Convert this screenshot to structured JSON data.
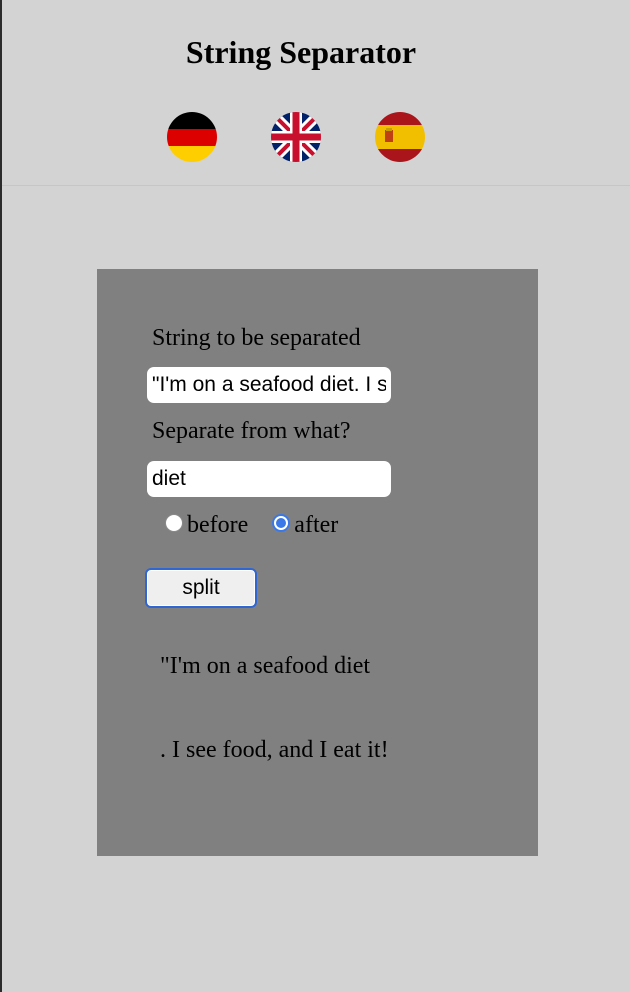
{
  "header": {
    "title": "String Separator",
    "languages": [
      {
        "code": "de",
        "icon": "germany-flag-icon"
      },
      {
        "code": "en",
        "icon": "uk-flag-icon"
      },
      {
        "code": "es",
        "icon": "spain-flag-icon"
      }
    ]
  },
  "form": {
    "string_label": "String to be separated",
    "string_value": "\"I'm on a seafood diet. I see food, and I eat it!",
    "separator_label": "Separate from what?",
    "separator_value": "diet",
    "options": [
      {
        "label": "before",
        "checked": false
      },
      {
        "label": "after",
        "checked": true
      }
    ],
    "split_label": "split"
  },
  "results": {
    "part1": "\"I'm on a seafood diet",
    "part2": ". I see food, and I eat it!"
  },
  "colors": {
    "background": "#d3d3d3",
    "panel": "#808080",
    "accent": "#3b78e7"
  }
}
